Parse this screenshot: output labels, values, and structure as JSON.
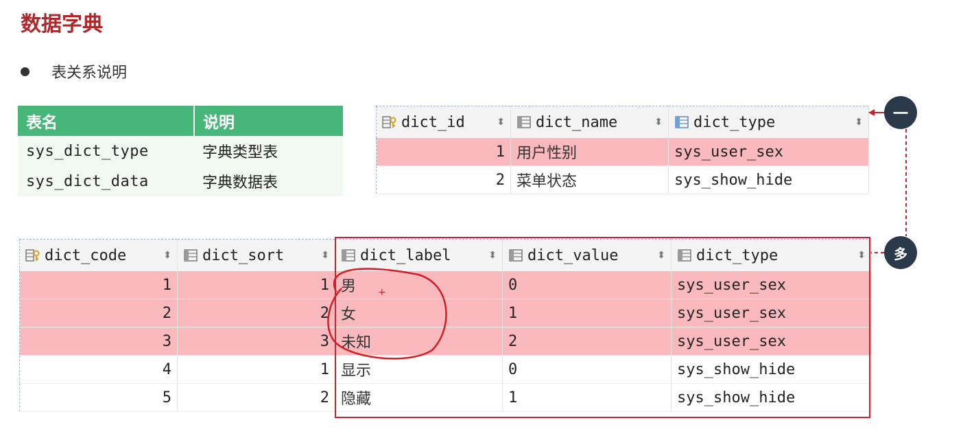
{
  "title": "数据字典",
  "bullet": "表关系说明",
  "summary_table": {
    "headers": [
      "表名",
      "说明"
    ],
    "rows": [
      [
        "sys_dict_type",
        "字典类型表"
      ],
      [
        "sys_dict_data",
        "字典数据表"
      ]
    ]
  },
  "dict_type_grid": {
    "columns": [
      {
        "label": "dict_id",
        "icon": "primary-key-icon"
      },
      {
        "label": "dict_name",
        "icon": "column-icon"
      },
      {
        "label": "dict_type",
        "icon": "column-icon"
      }
    ],
    "rows": [
      {
        "dict_id": "1",
        "dict_name": "用户性别",
        "dict_type": "sys_user_sex",
        "highlight": true
      },
      {
        "dict_id": "2",
        "dict_name": "菜单状态",
        "dict_type": "sys_show_hide",
        "highlight": false
      }
    ]
  },
  "dict_data_grid": {
    "columns": [
      {
        "label": "dict_code",
        "icon": "primary-key-icon"
      },
      {
        "label": "dict_sort",
        "icon": "column-icon"
      },
      {
        "label": "dict_label",
        "icon": "column-icon"
      },
      {
        "label": "dict_value",
        "icon": "column-icon"
      },
      {
        "label": "dict_type",
        "icon": "column-icon"
      }
    ],
    "rows": [
      {
        "dict_code": "1",
        "dict_sort": "1",
        "dict_label": "男",
        "dict_value": "0",
        "dict_type": "sys_user_sex",
        "highlight": true
      },
      {
        "dict_code": "2",
        "dict_sort": "2",
        "dict_label": "女",
        "dict_value": "1",
        "dict_type": "sys_user_sex",
        "highlight": true
      },
      {
        "dict_code": "3",
        "dict_sort": "3",
        "dict_label": "未知",
        "dict_value": "2",
        "dict_type": "sys_user_sex",
        "highlight": true
      },
      {
        "dict_code": "4",
        "dict_sort": "1",
        "dict_label": "显示",
        "dict_value": "0",
        "dict_type": "sys_show_hide",
        "highlight": false
      },
      {
        "dict_code": "5",
        "dict_sort": "2",
        "dict_label": "隐藏",
        "dict_value": "1",
        "dict_type": "sys_show_hide",
        "highlight": false
      }
    ]
  },
  "relation": {
    "one_label": "一",
    "many_label": "多"
  },
  "colors": {
    "title": "#b0262b",
    "header_green": "#47b779",
    "highlight_row": "#f9b9bd",
    "annotation_red": "#c0262e",
    "circle": "#2b3a4a"
  }
}
